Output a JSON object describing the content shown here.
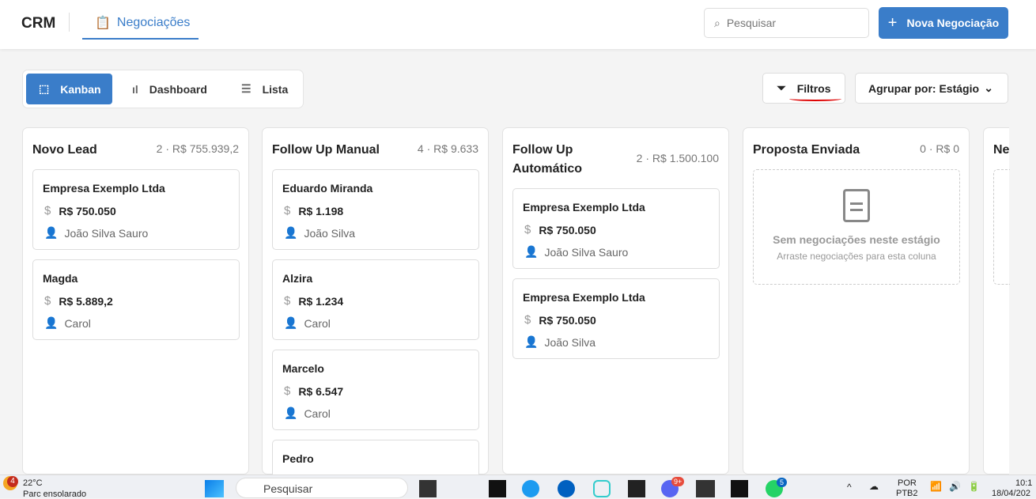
{
  "header": {
    "logo": "CRM",
    "nav_tab": "Negociações",
    "search_placeholder": "Pesquisar",
    "new_button": "Nova Negociação"
  },
  "views": [
    {
      "label": "Kanban",
      "active": true
    },
    {
      "label": "Dashboard"
    },
    {
      "label": "Lista"
    }
  ],
  "toolbar": {
    "filters": "Filtros",
    "group_by": "Agrupar por: Estágio"
  },
  "columns": [
    {
      "title": "Novo Lead",
      "count": "2",
      "total": "R$ 755.939,2",
      "cards": [
        {
          "name": "Empresa Exemplo Ltda",
          "value": "R$ 750.050",
          "owner": "João Silva Sauro"
        },
        {
          "name": "Magda",
          "value": "R$ 5.889,2",
          "owner": "Carol"
        }
      ]
    },
    {
      "title": "Follow Up Manual",
      "count": "4",
      "total": "R$ 9.633",
      "cards": [
        {
          "name": "Eduardo Miranda",
          "value": "R$ 1.198",
          "owner": "João Silva"
        },
        {
          "name": "Alzira",
          "value": "R$ 1.234",
          "owner": "Carol"
        },
        {
          "name": "Marcelo",
          "value": "R$ 6.547",
          "owner": "Carol"
        },
        {
          "name": "Pedro",
          "value": "",
          "owner": ""
        }
      ]
    },
    {
      "title": "Follow Up Automático",
      "count": "2",
      "total": "R$ 1.500.100",
      "cards": [
        {
          "name": "Empresa Exemplo Ltda",
          "value": "R$ 750.050",
          "owner": "João Silva Sauro"
        },
        {
          "name": "Empresa Exemplo Ltda",
          "value": "R$ 750.050",
          "owner": "João Silva"
        }
      ]
    },
    {
      "title": "Proposta Enviada",
      "count": "0",
      "total": "R$ 0",
      "empty_title": "Sem negociações neste estágio",
      "empty_sub": "Arraste negociações para esta coluna"
    },
    {
      "title": "Ne"
    }
  ],
  "taskbar": {
    "weather_badge": "4",
    "temp": "22°C",
    "weather": "Parc ensolarado",
    "search": "Pesquisar",
    "discord_badge": "9+",
    "whatsapp_badge": "5",
    "lang": "POR",
    "layout": "PTB2",
    "time": "10:1",
    "date": "18/04/202"
  }
}
